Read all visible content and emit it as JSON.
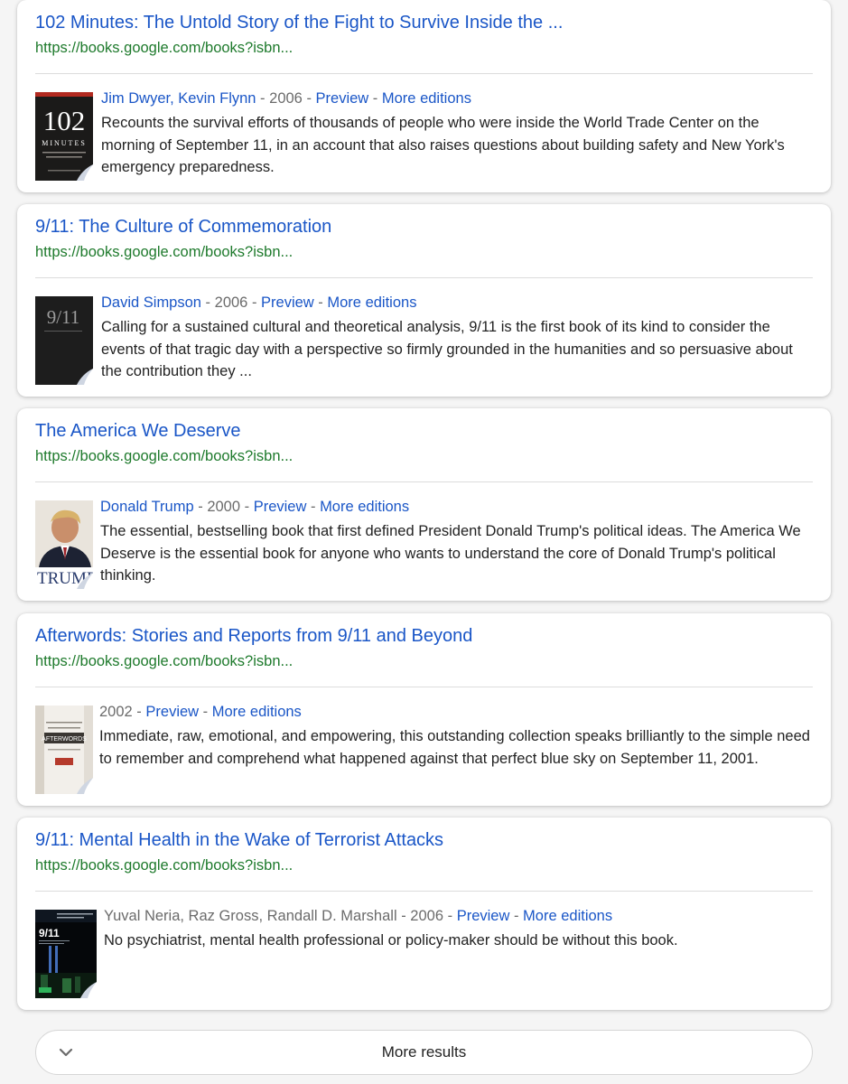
{
  "colors": {
    "link": "#1a56c7",
    "url": "#1e7a2c",
    "meta": "#6b6b6b",
    "text": "#222222"
  },
  "results": [
    {
      "title": "102 Minutes: The Untold Story of the Fight to Survive Inside the ...",
      "url": "https://books.google.com/books?isbn...",
      "authors": "Jim Dwyer, Kevin Flynn",
      "authors_are_links": true,
      "year": "2006",
      "preview": "Preview",
      "editions": "More editions",
      "description": "Recounts the survival efforts of thousands of people who were inside the World Trade Center on the morning of September 11, in an account that also raises questions about building safety and New York's emergency preparedness.",
      "cover": {
        "title_text": "102",
        "subtitle_text": "MINUTES"
      }
    },
    {
      "title": "9/11: The Culture of Commemoration",
      "url": "https://books.google.com/books?isbn...",
      "authors": "David Simpson",
      "authors_are_links": true,
      "year": "2006",
      "preview": "Preview",
      "editions": "More editions",
      "description": "Calling for a sustained cultural and theoretical analysis, 9/11 is the first book of its kind to consider the events of that tragic day with a perspective so firmly grounded in the humanities and so persuasive about the contribution they ...",
      "cover": {
        "title_text": "9/11"
      }
    },
    {
      "title": "The America We Deserve",
      "url": "https://books.google.com/books?isbn...",
      "authors": "Donald Trump",
      "authors_are_links": true,
      "year": "2000",
      "preview": "Preview",
      "editions": "More editions",
      "description": "The essential, bestselling book that first defined President Donald Trump's political ideas. The America We Deserve is the essential book for anyone who wants to understand the core of Donald Trump's political thinking.",
      "cover": {
        "title_text": "TRUMP"
      }
    },
    {
      "title": "Afterwords: Stories and Reports from 9/11 and Beyond",
      "url": "https://books.google.com/books?isbn...",
      "authors": "",
      "authors_are_links": false,
      "year": "2002",
      "preview": "Preview",
      "editions": "More editions",
      "description": "Immediate, raw, emotional, and empowering, this outstanding collection speaks brilliantly to the simple need to remember and comprehend what happened against that perfect blue sky on September 11, 2001.",
      "cover": {
        "title_text": "AFTERWORDS"
      }
    },
    {
      "title": "9/11: Mental Health in the Wake of Terrorist Attacks",
      "url": "https://books.google.com/books?isbn...",
      "authors": "Yuval Neria, Raz Gross, Randall D. Marshall",
      "authors_are_links": false,
      "year": "2006",
      "preview": "Preview",
      "editions": "More editions",
      "description": "No psychiatrist, mental health professional or policy-maker should be without this book.",
      "cover": {
        "title_text": "9/11"
      }
    }
  ],
  "more_results": {
    "label": "More results",
    "icon": "chevron-down-icon"
  }
}
